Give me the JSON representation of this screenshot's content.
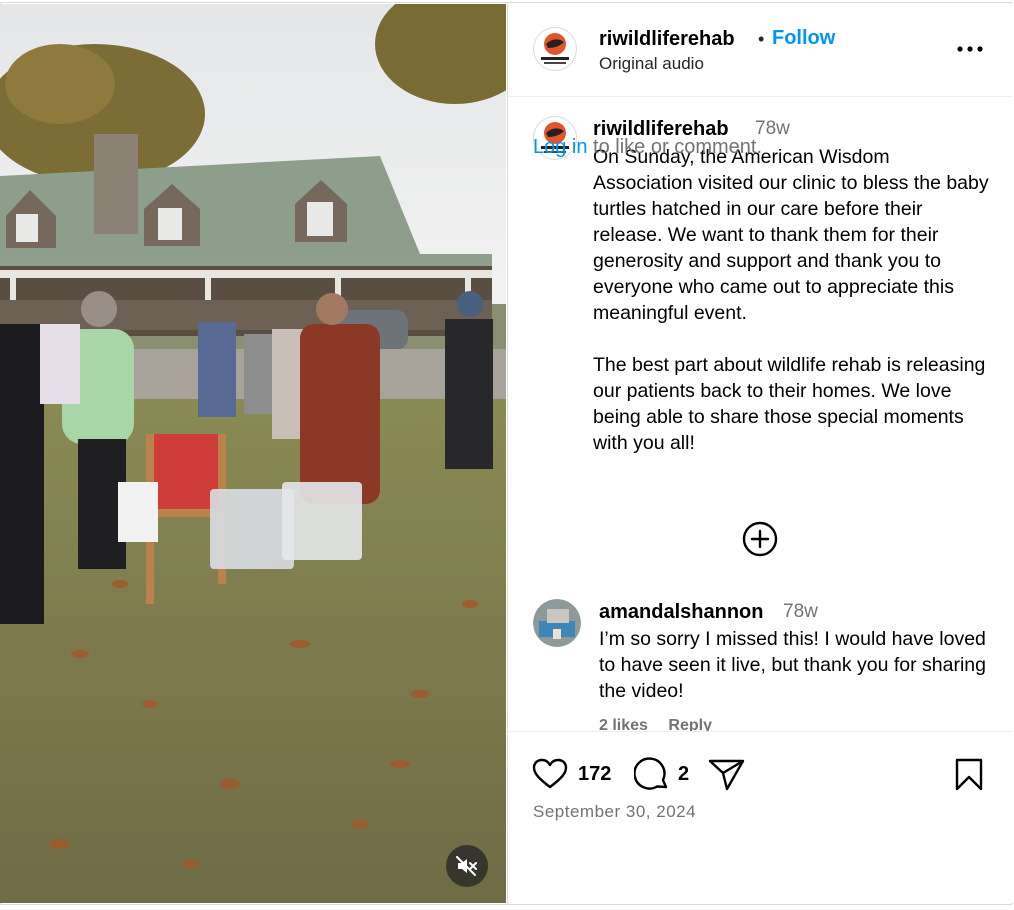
{
  "post": {
    "author": "riwildliferehab",
    "follow_label": "Follow",
    "audio_label": "Original audio",
    "more_icon": "more-horizontal-icon",
    "mute_icon": "speaker-muted-icon",
    "avatar_text": "WILDLIFE CLINIC"
  },
  "caption": {
    "username": "riwildliferehab",
    "time": "78w",
    "text": "On Sunday, the American Wisdom Association visited our clinic to bless the baby turtles hatched in our care before their release. We want to thank them for their generosity and support and thank you to everyone who came out to appreciate this meaningful event.\n\nThe best part about wildlife rehab is releasing our patients back to their homes. We love being able to share those special moments with you all!"
  },
  "load_more_icon": "plus-circle-icon",
  "comments": [
    {
      "username": "amandalshannon",
      "time": "78w",
      "text": "I’m so sorry I missed this! I would have loved to have seen it live, but thank you for sharing the video!",
      "likes": "2 likes",
      "reply_label": "Reply"
    }
  ],
  "actions": {
    "like_count": "172",
    "comment_count": "2",
    "date": "September 30, 2024"
  },
  "login_prompt": {
    "link": "Log in",
    "rest": " to like or comment."
  },
  "colors": {
    "link_blue": "#0095f6",
    "muted_gray": "#737373",
    "border": "#dbdbdb"
  }
}
